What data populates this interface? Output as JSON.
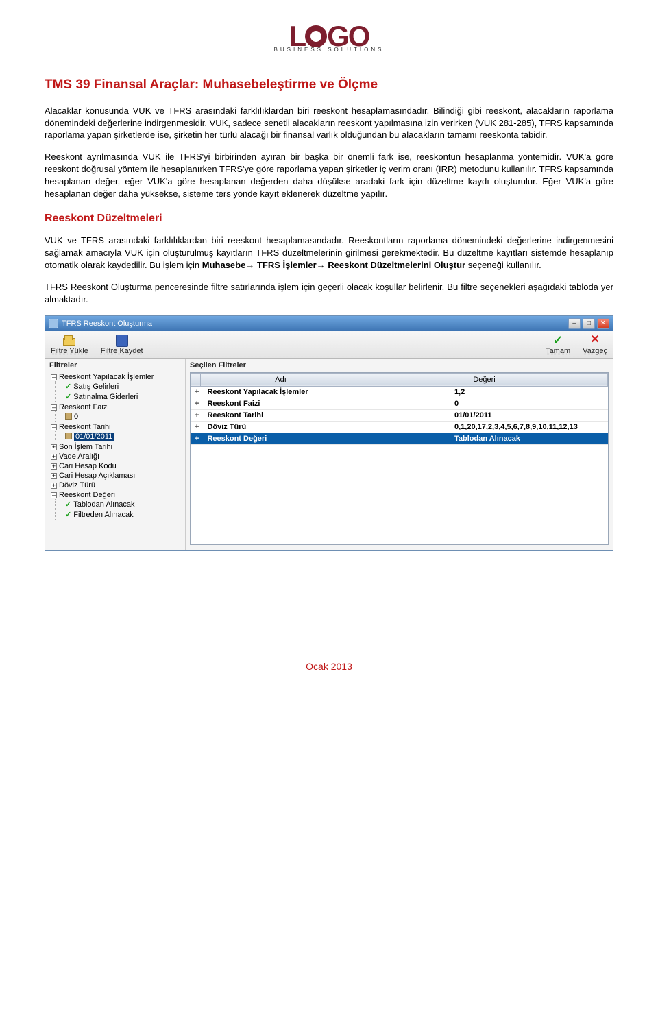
{
  "header": {
    "logo_tagline": "BUSINESS SOLUTIONS"
  },
  "doc": {
    "title": "TMS 39 Finansal Araçlar: Muhasebeleştirme ve Ölçme",
    "p1": "Alacaklar konusunda VUK ve TFRS arasındaki farklılıklardan biri reeskont hesaplamasındadır. Bilindiği gibi reeskont, alacakların raporlama dönemindeki değerlerine indirgenmesidir. VUK, sadece senetli alacakların reeskont yapılmasına izin verirken (VUK 281-285), TFRS kapsamında raporlama yapan şirketlerde ise, şirketin her türlü alacağı bir finansal varlık olduğundan bu alacakların tamamı reeskonta tabidir.",
    "p2": "Reeskont ayrılmasında VUK ile TFRS'yi birbirinden ayıran bir başka bir önemli fark ise, reeskontun hesaplanma yöntemidir. VUK'a göre reeskont doğrusal yöntem ile hesaplanırken TFRS'ye göre raporlama yapan şirketler iç verim oranı (IRR) metodunu kullanılır. TFRS kapsamında hesaplanan değer, eğer VUK'a göre hesaplanan değerden daha düşükse aradaki fark için düzeltme kaydı oluşturulur. Eğer VUK'a göre hesaplanan değer daha yüksekse, sisteme ters yönde kayıt eklenerek düzeltme yapılır.",
    "h2": "Reeskont Düzeltmeleri",
    "p3a": "VUK ve TFRS arasındaki farklılıklardan biri reeskont hesaplamasındadır. Reeskontların raporlama dönemindeki değerlerine indirgenmesini sağlamak amacıyla VUK için oluşturulmuş kayıtların TFRS düzeltmelerinin girilmesi gerekmektedir. Bu düzeltme kayıtları sistemde hesaplanıp otomatik olarak kaydedilir. Bu işlem için ",
    "nav1": "Muhasebe",
    "nav2": "TFRS İşlemler",
    "nav3": "Reeskont Düzeltmelerini Oluştur",
    "p3b": " seçeneği kullanılır.",
    "p4": "TFRS Reeskont Oluşturma penceresinde filtre satırlarında işlem için geçerli olacak koşullar belirlenir. Bu filtre seçenekleri aşağıdaki tabloda yer almaktadır."
  },
  "app": {
    "title": "TFRS Reeskont Oluşturma",
    "toolbar": {
      "filtre_yukle": "Filtre Yükle",
      "filtre_kaydet": "Filtre Kaydet",
      "tamam": "Tamam",
      "vazgec": "Vazgeç"
    },
    "left": {
      "title": "Filtreler",
      "tree": {
        "n1": "Reeskont Yapılacak İşlemler",
        "n1a": "Satış Gelirleri",
        "n1b": "Satınalma Giderleri",
        "n2": "Reeskont Faizi",
        "n2a": "0",
        "n3": "Reeskont Tarihi",
        "n3a": "01/01/2011",
        "n4": "Son İşlem Tarihi",
        "n5": "Vade Aralığı",
        "n6": "Cari Hesap Kodu",
        "n7": "Cari Hesap Açıklaması",
        "n8": "Döviz Türü",
        "n9": "Reeskont Değeri",
        "n9a": "Tablodan Alınacak",
        "n9b": "Filtreden Alınacak"
      }
    },
    "right": {
      "title": "Seçilen Filtreler",
      "col_adi": "Adı",
      "col_degeri": "Değeri",
      "rows": [
        {
          "pm": "+",
          "name": "Reeskont Yapılacak İşlemler",
          "val": "1,2"
        },
        {
          "pm": "+",
          "name": "Reeskont Faizi",
          "val": "0"
        },
        {
          "pm": "+",
          "name": "Reeskont Tarihi",
          "val": "01/01/2011"
        },
        {
          "pm": "+",
          "name": "Döviz Türü",
          "val": "0,1,20,17,2,3,4,5,6,7,8,9,10,11,12,13"
        },
        {
          "pm": "+",
          "name": "Reeskont Değeri",
          "val": "Tablodan Alınacak",
          "hl": true
        }
      ]
    }
  },
  "footer": "Ocak 2013"
}
